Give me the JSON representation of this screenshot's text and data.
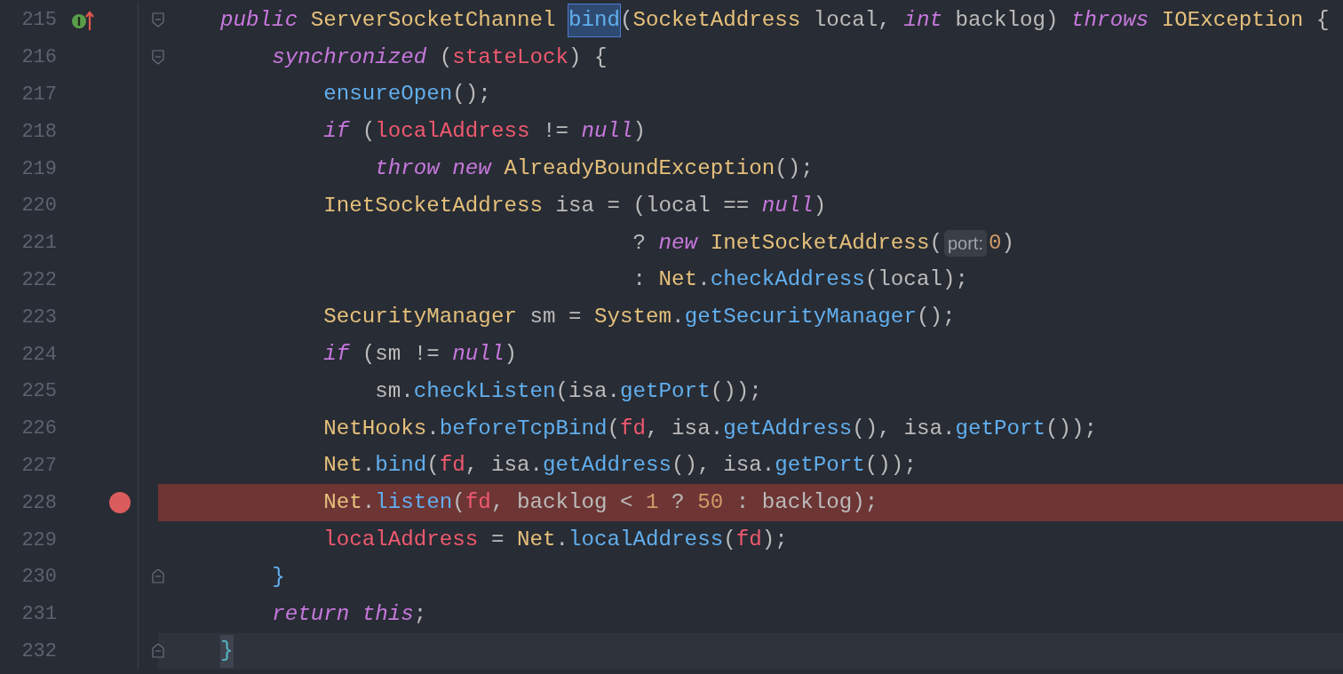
{
  "editor": {
    "lines": [
      {
        "number": "215",
        "breakpoint": false,
        "override": true,
        "fold_start": true,
        "fold_end": false,
        "caret_line": false,
        "tokens": [
          {
            "kind": "kw",
            "text": "    public "
          },
          {
            "kind": "type",
            "text": "ServerSocketChannel "
          },
          {
            "kind": "usage",
            "text": "bind"
          },
          {
            "kind": "plain",
            "text": "("
          },
          {
            "kind": "type",
            "text": "SocketAddress"
          },
          {
            "kind": "plain",
            "text": " local, "
          },
          {
            "kind": "kw",
            "text": "int"
          },
          {
            "kind": "plain",
            "text": " backlog) "
          },
          {
            "kind": "kw",
            "text": "throws "
          },
          {
            "kind": "type",
            "text": "IOException"
          },
          {
            "kind": "plain",
            "text": " {"
          }
        ]
      },
      {
        "number": "216",
        "breakpoint": false,
        "override": false,
        "fold_start": true,
        "fold_end": false,
        "caret_line": false,
        "tokens": [
          {
            "kind": "kw",
            "text": "        synchronized"
          },
          {
            "kind": "plain",
            "text": " ("
          },
          {
            "kind": "field",
            "text": "stateLock"
          },
          {
            "kind": "plain",
            "text": ") {"
          }
        ]
      },
      {
        "number": "217",
        "breakpoint": false,
        "override": false,
        "fold_start": false,
        "fold_end": false,
        "caret_line": false,
        "tokens": [
          {
            "kind": "method",
            "text": "            ensureOpen"
          },
          {
            "kind": "plain",
            "text": "();"
          }
        ]
      },
      {
        "number": "218",
        "breakpoint": false,
        "override": false,
        "fold_start": false,
        "fold_end": false,
        "caret_line": false,
        "tokens": [
          {
            "kind": "kw",
            "text": "            if"
          },
          {
            "kind": "plain",
            "text": " ("
          },
          {
            "kind": "field",
            "text": "localAddress"
          },
          {
            "kind": "plain",
            "text": " != "
          },
          {
            "kind": "kw",
            "text": "null"
          },
          {
            "kind": "plain",
            "text": ")"
          }
        ]
      },
      {
        "number": "219",
        "breakpoint": false,
        "override": false,
        "fold_start": false,
        "fold_end": false,
        "caret_line": false,
        "tokens": [
          {
            "kind": "kw",
            "text": "                throw "
          },
          {
            "kind": "kw",
            "text": "new "
          },
          {
            "kind": "type",
            "text": "AlreadyBoundException"
          },
          {
            "kind": "plain",
            "text": "();"
          }
        ]
      },
      {
        "number": "220",
        "breakpoint": false,
        "override": false,
        "fold_start": false,
        "fold_end": false,
        "caret_line": false,
        "tokens": [
          {
            "kind": "type",
            "text": "            InetSocketAddress"
          },
          {
            "kind": "plain",
            "text": " isa = (local == "
          },
          {
            "kind": "kw",
            "text": "null"
          },
          {
            "kind": "plain",
            "text": ")"
          }
        ]
      },
      {
        "number": "221",
        "breakpoint": false,
        "override": false,
        "fold_start": false,
        "fold_end": false,
        "caret_line": false,
        "tokens": [
          {
            "kind": "plain",
            "text": "                                    ? "
          },
          {
            "kind": "kw",
            "text": "new "
          },
          {
            "kind": "type",
            "text": "InetSocketAddress"
          },
          {
            "kind": "plain",
            "text": "("
          },
          {
            "kind": "hint",
            "text": "port:"
          },
          {
            "kind": "num",
            "text": "0"
          },
          {
            "kind": "plain",
            "text": ")"
          }
        ]
      },
      {
        "number": "222",
        "breakpoint": false,
        "override": false,
        "fold_start": false,
        "fold_end": false,
        "caret_line": false,
        "tokens": [
          {
            "kind": "plain",
            "text": "                                    : "
          },
          {
            "kind": "type",
            "text": "Net"
          },
          {
            "kind": "plain",
            "text": "."
          },
          {
            "kind": "method",
            "text": "checkAddress"
          },
          {
            "kind": "plain",
            "text": "(local);"
          }
        ]
      },
      {
        "number": "223",
        "breakpoint": false,
        "override": false,
        "fold_start": false,
        "fold_end": false,
        "caret_line": false,
        "tokens": [
          {
            "kind": "type",
            "text": "            SecurityManager"
          },
          {
            "kind": "plain",
            "text": " sm = "
          },
          {
            "kind": "type",
            "text": "System"
          },
          {
            "kind": "plain",
            "text": "."
          },
          {
            "kind": "method",
            "text": "getSecurityManager"
          },
          {
            "kind": "plain",
            "text": "();"
          }
        ]
      },
      {
        "number": "224",
        "breakpoint": false,
        "override": false,
        "fold_start": false,
        "fold_end": false,
        "caret_line": false,
        "tokens": [
          {
            "kind": "kw",
            "text": "            if"
          },
          {
            "kind": "plain",
            "text": " (sm != "
          },
          {
            "kind": "kw",
            "text": "null"
          },
          {
            "kind": "plain",
            "text": ")"
          }
        ]
      },
      {
        "number": "225",
        "breakpoint": false,
        "override": false,
        "fold_start": false,
        "fold_end": false,
        "caret_line": false,
        "tokens": [
          {
            "kind": "plain",
            "text": "                sm."
          },
          {
            "kind": "method",
            "text": "checkListen"
          },
          {
            "kind": "plain",
            "text": "(isa."
          },
          {
            "kind": "method",
            "text": "getPort"
          },
          {
            "kind": "plain",
            "text": "());"
          }
        ]
      },
      {
        "number": "226",
        "breakpoint": false,
        "override": false,
        "fold_start": false,
        "fold_end": false,
        "caret_line": false,
        "tokens": [
          {
            "kind": "type",
            "text": "            NetHooks"
          },
          {
            "kind": "plain",
            "text": "."
          },
          {
            "kind": "method",
            "text": "beforeTcpBind"
          },
          {
            "kind": "plain",
            "text": "("
          },
          {
            "kind": "field",
            "text": "fd"
          },
          {
            "kind": "plain",
            "text": ", isa."
          },
          {
            "kind": "method",
            "text": "getAddress"
          },
          {
            "kind": "plain",
            "text": "(), isa."
          },
          {
            "kind": "method",
            "text": "getPort"
          },
          {
            "kind": "plain",
            "text": "());"
          }
        ]
      },
      {
        "number": "227",
        "breakpoint": false,
        "override": false,
        "fold_start": false,
        "fold_end": false,
        "caret_line": false,
        "tokens": [
          {
            "kind": "type",
            "text": "            Net"
          },
          {
            "kind": "plain",
            "text": "."
          },
          {
            "kind": "method",
            "text": "bind"
          },
          {
            "kind": "plain",
            "text": "("
          },
          {
            "kind": "field",
            "text": "fd"
          },
          {
            "kind": "plain",
            "text": ", isa."
          },
          {
            "kind": "method",
            "text": "getAddress"
          },
          {
            "kind": "plain",
            "text": "(), isa."
          },
          {
            "kind": "method",
            "text": "getPort"
          },
          {
            "kind": "plain",
            "text": "());"
          }
        ]
      },
      {
        "number": "228",
        "breakpoint": true,
        "override": false,
        "fold_start": false,
        "fold_end": false,
        "caret_line": false,
        "tokens": [
          {
            "kind": "type",
            "text": "            Net"
          },
          {
            "kind": "plain",
            "text": "."
          },
          {
            "kind": "method",
            "text": "listen"
          },
          {
            "kind": "plain",
            "text": "("
          },
          {
            "kind": "field",
            "text": "fd"
          },
          {
            "kind": "plain",
            "text": ", backlog < "
          },
          {
            "kind": "num",
            "text": "1"
          },
          {
            "kind": "plain",
            "text": " ? "
          },
          {
            "kind": "num",
            "text": "50"
          },
          {
            "kind": "plain",
            "text": " : backlog);"
          }
        ]
      },
      {
        "number": "229",
        "breakpoint": false,
        "override": false,
        "fold_start": false,
        "fold_end": false,
        "caret_line": false,
        "tokens": [
          {
            "kind": "field",
            "text": "            localAddress"
          },
          {
            "kind": "plain",
            "text": " = "
          },
          {
            "kind": "type",
            "text": "Net"
          },
          {
            "kind": "plain",
            "text": "."
          },
          {
            "kind": "method",
            "text": "localAddress"
          },
          {
            "kind": "plain",
            "text": "("
          },
          {
            "kind": "field",
            "text": "fd"
          },
          {
            "kind": "plain",
            "text": ");"
          }
        ]
      },
      {
        "number": "230",
        "breakpoint": false,
        "override": false,
        "fold_start": false,
        "fold_end": true,
        "caret_line": false,
        "tokens": [
          {
            "kind": "brace",
            "text": "        }"
          }
        ]
      },
      {
        "number": "231",
        "breakpoint": false,
        "override": false,
        "fold_start": false,
        "fold_end": false,
        "caret_line": false,
        "tokens": [
          {
            "kind": "kw",
            "text": "        return "
          },
          {
            "kind": "kw",
            "text": "this"
          },
          {
            "kind": "plain",
            "text": ";"
          }
        ]
      },
      {
        "number": "232",
        "breakpoint": false,
        "override": false,
        "fold_start": false,
        "fold_end": true,
        "caret_line": true,
        "tokens": [
          {
            "kind": "brace-match",
            "text": "    }"
          }
        ]
      }
    ]
  }
}
